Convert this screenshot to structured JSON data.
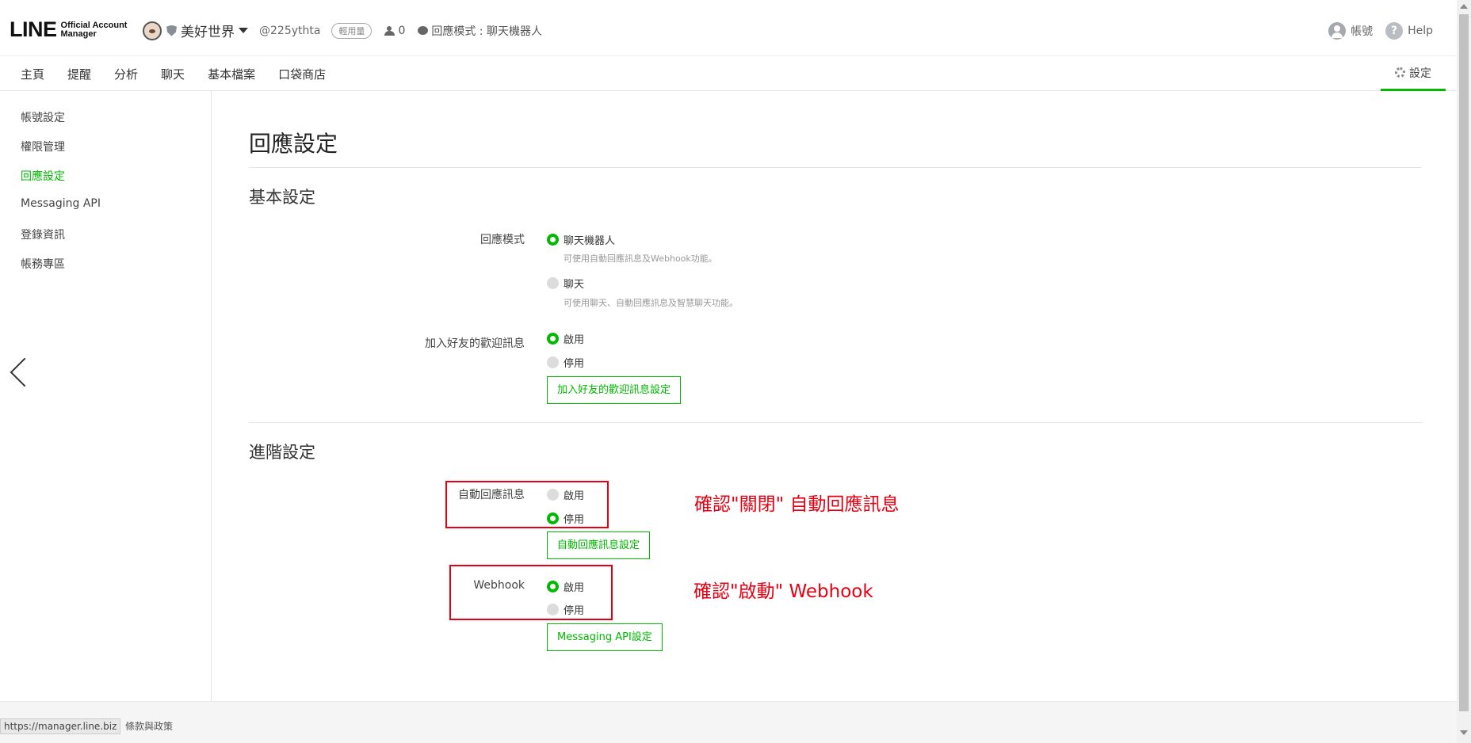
{
  "header": {
    "logo_text": "LINE",
    "logo_sub_1": "Official Account",
    "logo_sub_2": "Manager",
    "account_name": "美好世界",
    "account_id": "@225ythta",
    "plan_badge": "輕用量",
    "friends_count": "0",
    "reply_mode": "回應模式 : 聊天機器人",
    "account_link": "帳號",
    "help_link": "Help"
  },
  "nav": {
    "items": [
      "主頁",
      "提醒",
      "分析",
      "聊天",
      "基本檔案",
      "口袋商店"
    ],
    "settings": "設定"
  },
  "sidebar": {
    "items": [
      {
        "label": "帳號設定",
        "active": false
      },
      {
        "label": "權限管理",
        "active": false
      },
      {
        "label": "回應設定",
        "active": true
      },
      {
        "label": "Messaging API",
        "active": false
      },
      {
        "label": "登錄資訊",
        "active": false
      },
      {
        "label": "帳務專區",
        "active": false
      }
    ]
  },
  "main": {
    "page_title": "回應設定",
    "basic": {
      "title": "基本設定",
      "reply_mode_label": "回應模式",
      "opt_bot": "聊天機器人",
      "opt_bot_hint": "可使用自動回應訊息及Webhook功能。",
      "opt_chat": "聊天",
      "opt_chat_hint": "可使用聊天、自動回應訊息及智慧聊天功能。",
      "welcome_label": "加入好友的歡迎訊息",
      "welcome_on": "啟用",
      "welcome_off": "停用",
      "welcome_btn": "加入好友的歡迎訊息設定"
    },
    "advanced": {
      "title": "進階設定",
      "auto_reply_label": "自動回應訊息",
      "auto_on": "啟用",
      "auto_off": "停用",
      "auto_btn": "自動回應訊息設定",
      "webhook_label": "Webhook",
      "webhook_on": "啟用",
      "webhook_off": "停用",
      "webhook_btn": "Messaging API設定"
    },
    "annotations": {
      "auto_reply_note": "確認\"關閉\" 自動回應訊息",
      "webhook_note": "確認\"啟動\" Webhook"
    }
  },
  "footer": {
    "terms": "條款與政策",
    "status_url": "https://manager.line.biz"
  },
  "colors": {
    "accent": "#00b900",
    "annotation": "#e60012"
  }
}
